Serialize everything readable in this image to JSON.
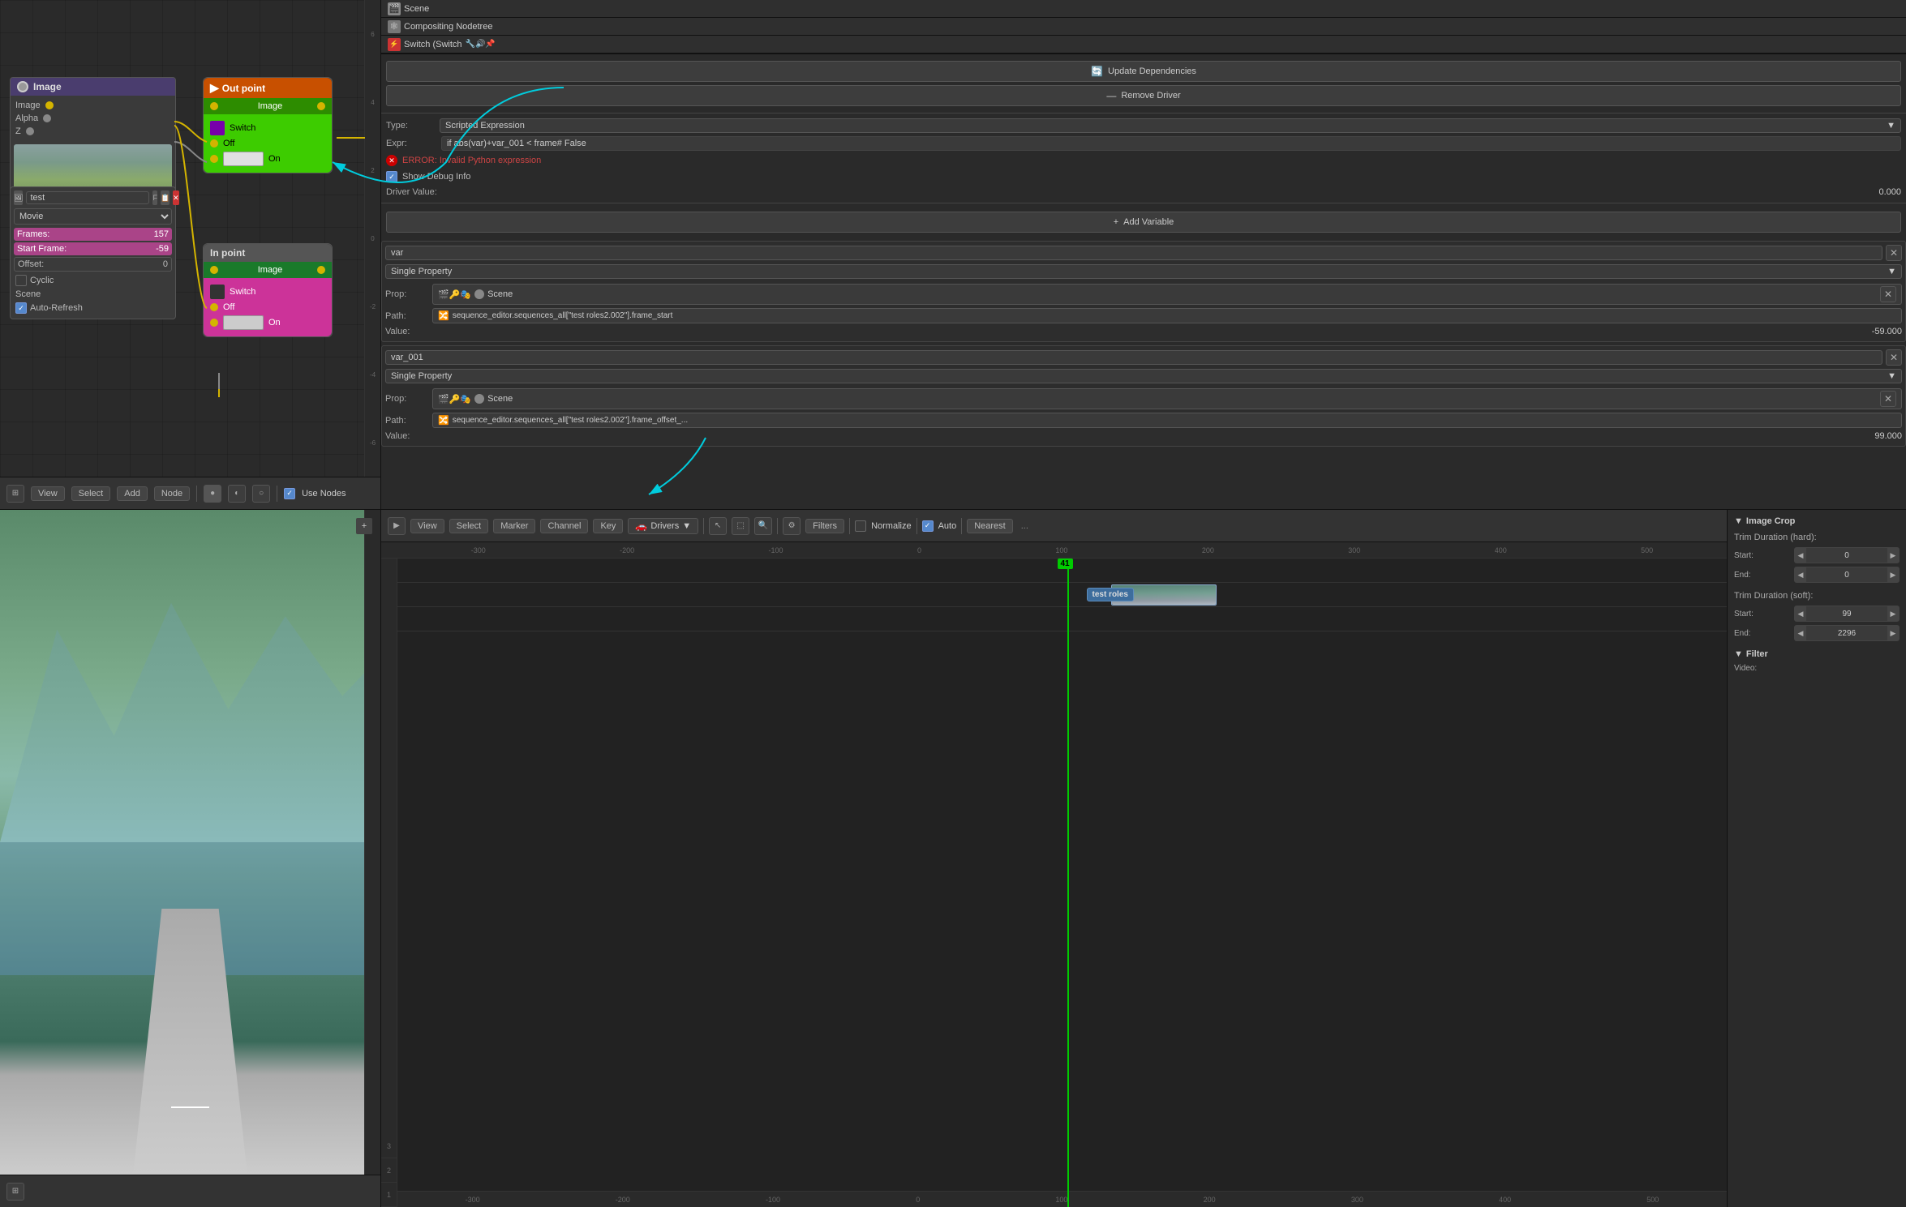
{
  "header": {
    "scene_label": "Scene",
    "compositing_label": "Compositing Nodetree",
    "switch_label": "Switch (Switch",
    "update_deps_label": "Update Dependencies",
    "remove_driver_label": "Remove Driver"
  },
  "driver": {
    "type_label": "Type:",
    "type_value": "Scripted Expression",
    "expr_label": "Expr:",
    "expr_value": "if abs(var)+var_001 < frame# False",
    "error_text": "ERROR: Invalid Python expression",
    "debug_label": "Show Debug Info",
    "driver_value_label": "Driver Value:",
    "driver_value": "0.000",
    "add_variable_label": "Add Variable"
  },
  "var1": {
    "name": "var",
    "type": "Single Property",
    "prop_label": "Prop:",
    "prop_value": "Scene",
    "path_label": "Path:",
    "path_value": "sequence_editor.sequences_all[\"test roles2.002\"].frame_start",
    "value_label": "Value:",
    "value": "-59.000"
  },
  "var2": {
    "name": "var_001",
    "type": "Single Property",
    "prop_label": "Prop:",
    "prop_value": "Scene",
    "path_label": "Path:",
    "path_value": "sequence_editor.sequences_all[\"test roles2.002\"].frame_offset_...",
    "value_label": "Value:",
    "value": "99.000"
  },
  "nodes": {
    "image_header": "Image",
    "image_socket1": "Image",
    "image_socket2": "Alpha",
    "image_socket3": "Z",
    "out_point_header": "Out point",
    "out_point_image": "Image",
    "out_point_switch": "Switch",
    "out_point_off": "Off",
    "out_point_on": "On",
    "in_point_header": "In point",
    "in_point_image": "Image",
    "in_point_switch": "Switch",
    "in_point_off": "Off",
    "in_point_on": "On"
  },
  "image_node_props": {
    "name": "test",
    "type": "Movie",
    "frames_label": "Frames:",
    "frames_value": "157",
    "start_frame_label": "Start Frame:",
    "start_frame_value": "-59",
    "offset_label": "Offset:",
    "offset_value": "0",
    "cyclic_label": "Cyclic",
    "scene_label": "Scene",
    "auto_refresh_label": "Auto-Refresh"
  },
  "seq_editor": {
    "toolbar": {
      "view": "View",
      "select": "Select",
      "marker": "Marker",
      "channel": "Channel",
      "key": "Key",
      "drivers": "Drivers",
      "filters": "Filters",
      "normalize": "Normalize",
      "auto": "Auto",
      "nearest": "Nearest"
    },
    "clip": {
      "label": "test roles",
      "frame": "41"
    },
    "ruler": {
      "marks": [
        "-300",
        "-200",
        "-100",
        "0",
        "100",
        "200",
        "300",
        "400",
        "500"
      ]
    }
  },
  "right_props": {
    "image_crop_label": "Image Crop",
    "trim_hard_label": "Trim Duration (hard):",
    "trim_hard_start_label": "Start:",
    "trim_hard_start_val": "0",
    "trim_hard_end_label": "End:",
    "trim_hard_end_val": "0",
    "trim_soft_label": "Trim Duration (soft):",
    "trim_soft_start_label": "Start:",
    "trim_soft_start_val": "99",
    "trim_soft_end_label": "End:",
    "trim_soft_end_val": "2296",
    "filter_label": "Filter",
    "video_label": "Video:"
  },
  "toolbar_node": {
    "view": "View",
    "select": "Select",
    "add": "Add",
    "node": "Node",
    "use_nodes": "Use Nodes"
  }
}
